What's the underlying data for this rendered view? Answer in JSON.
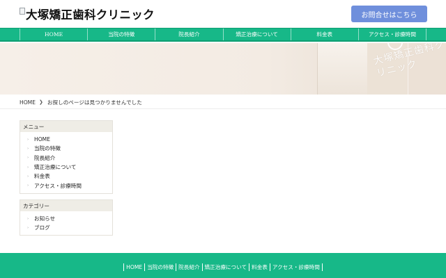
{
  "header": {
    "logo_alt": "大塚矯正歯科クリニック",
    "contact_button": "お問合せはこちら"
  },
  "nav": {
    "items": [
      "HOME",
      "当院の特徴",
      "院長紹介",
      "矯正治療について",
      "料金表",
      "アクセス・診療時間"
    ]
  },
  "hero": {
    "sign_text": "大塚矯正歯科クリニック"
  },
  "breadcrumb": {
    "home": "HOME",
    "current": "お探しのページは見つかりませんでした"
  },
  "sidebar": {
    "menu": {
      "title": "メニュー",
      "items": [
        "HOME",
        "当院の特徴",
        "院長紹介",
        "矯正治療について",
        "料金表",
        "アクセス・診療時間"
      ]
    },
    "category": {
      "title": "カテゴリー",
      "items": [
        "お知らせ",
        "ブログ"
      ]
    }
  },
  "footer": {
    "links": [
      "HOME",
      "当院の特徴",
      "院長紹介",
      "矯正治療について",
      "料金表",
      "アクセス・診療時間"
    ]
  },
  "colors": {
    "brand_green": "#17b888",
    "contact_blue": "#6f8fdc",
    "widget_header": "#efede6"
  }
}
